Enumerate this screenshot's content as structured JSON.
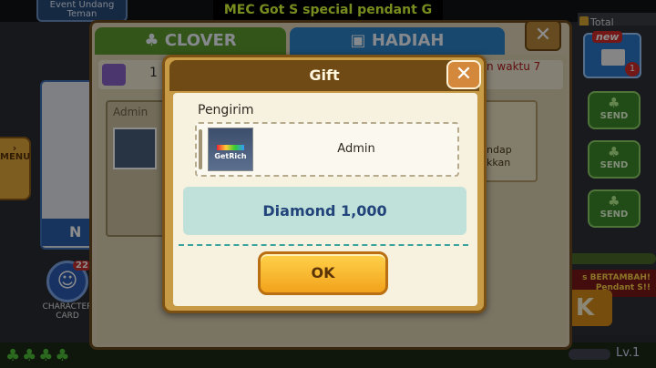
{
  "background": {
    "event_button": "Event Undang Teman",
    "ticker": "MEC Got  S special pendant G",
    "total_ranking": "Total Ranking",
    "menu_label": "MENU",
    "character_card_label": "CHARACTER CARD",
    "character_card_badge": "22",
    "mail_new_badge": "new",
    "mail_count": "1",
    "send_label": "SEND",
    "promo_text": "s BERTAMBAH! Pendant S!!",
    "big_ok_fragment": "K",
    "level_label": "Lv.1",
    "portrait_name_fragment": "N"
  },
  "main_panel": {
    "tabs": [
      {
        "label": "CLOVER",
        "icon": "clover-icon"
      },
      {
        "label": "HADIAH",
        "icon": "gift-icon"
      }
    ],
    "close_symbol": "✕",
    "gift_count": "1",
    "time_note": "n waktu 7",
    "admin_card_label": "Admin",
    "reward_text_line1": "ndap",
    "reward_text_line2": "kkan"
  },
  "dialog": {
    "title": "Gift",
    "close_symbol": "✕",
    "sender_label": "Pengirim",
    "sender_name": "Admin",
    "sender_logo_text": "GetRich",
    "gift_value": "Diamond 1,000",
    "ok_label": "OK"
  },
  "colors": {
    "dialog_frame": "#c79a45",
    "dialog_header": "#6f4a14",
    "gift_value_bg": "#bfe1da",
    "gift_value_text": "#22447a",
    "ok_button": "#f2a21c",
    "ticker_text": "#d8ff3a"
  }
}
